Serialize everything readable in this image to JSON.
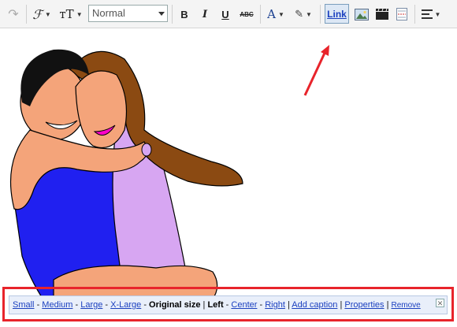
{
  "toolbar": {
    "font_style_value": "Normal",
    "link_label": "Link",
    "icons": [
      "redo-icon",
      "font-family-icon",
      "font-size-icon",
      "bold-icon",
      "italic-icon",
      "underline-icon",
      "strikethrough-icon",
      "text-color-icon",
      "highlight-color-icon",
      "link-button",
      "image-icon",
      "video-icon",
      "jump-break-icon",
      "align-icon"
    ],
    "bold_glyph": "B",
    "italic_glyph": "I",
    "underline_glyph": "U",
    "strike_glyph": "ABC",
    "text_color_glyph": "A"
  },
  "caption_bar": {
    "small": "Small",
    "medium": "Medium",
    "large": "Large",
    "xlarge": "X-Large",
    "original": "Original size",
    "left": "Left",
    "center": "Center",
    "right": "Right",
    "add_caption": "Add caption",
    "properties": "Properties",
    "remove": "Remove",
    "dash": " - ",
    "pipe": " | "
  },
  "colors": {
    "highlight_border": "#e8242b",
    "arrow": "#e8242b",
    "caption_bg": "#e9effa",
    "link_blue": "#1a3fbf"
  }
}
